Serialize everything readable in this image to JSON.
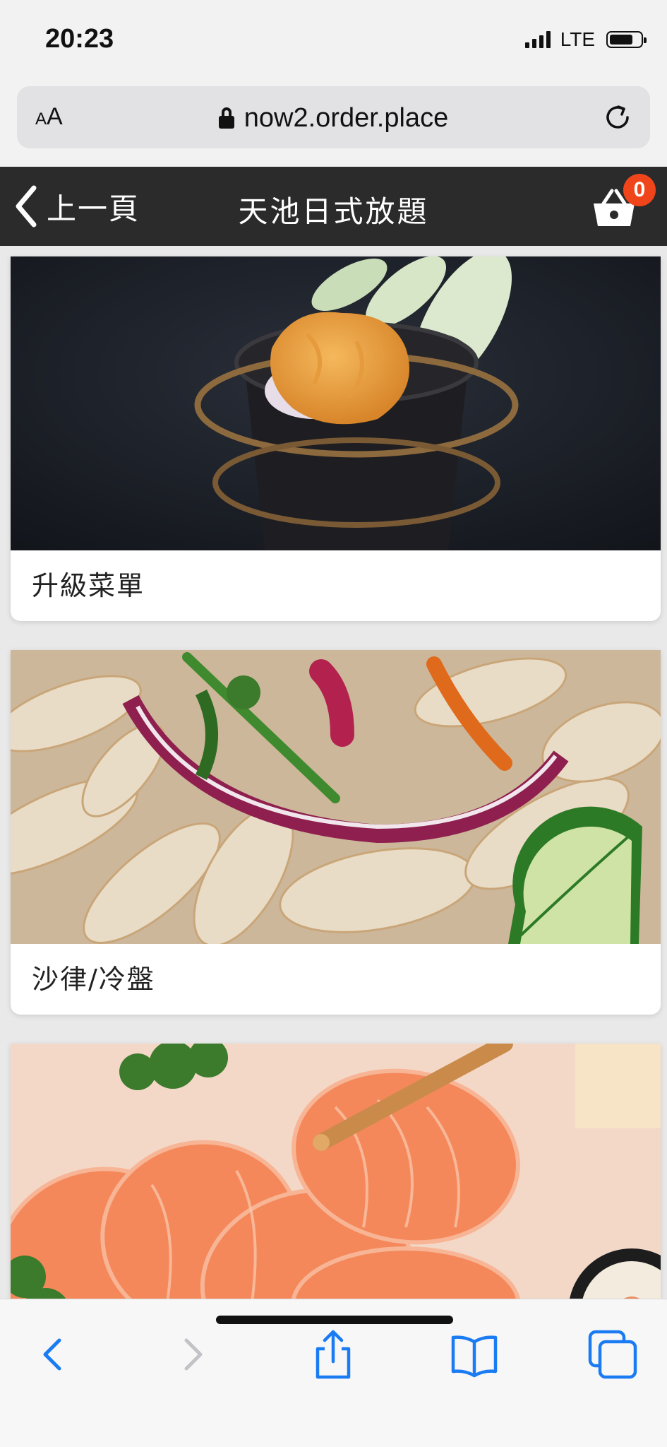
{
  "status_bar": {
    "time": "20:23",
    "network": "LTE",
    "battery_level": 0.75
  },
  "address_bar": {
    "text_size_small": "A",
    "text_size_big": "A",
    "url": "now2.order.place",
    "lock_icon": "lock-icon",
    "reload_icon": "reload-icon"
  },
  "header": {
    "back_label": "上一頁",
    "title": "天池日式放題",
    "cart_count": "0",
    "cart_icon": "basket-icon",
    "background": "#2b2b2b",
    "badge_color": "#f0451a"
  },
  "categories": [
    {
      "label": "升級菜單",
      "image": "sea-urchin-cone-photo"
    },
    {
      "label": "沙律/冷盤",
      "image": "fried-chicken-feet-salad-photo"
    },
    {
      "label": "",
      "image": "salmon-sashimi-photo"
    }
  ],
  "toolbar": {
    "back_icon": "back-arrow-icon",
    "forward_icon": "forward-arrow-icon",
    "share_icon": "share-icon",
    "bookmarks_icon": "book-icon",
    "tabs_icon": "tabs-icon",
    "accent": "#1a7bf2"
  }
}
